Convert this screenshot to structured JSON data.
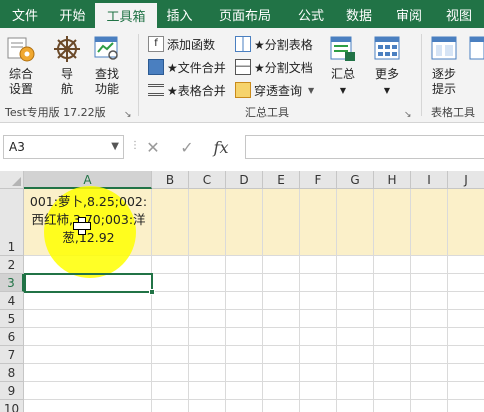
{
  "tabs": [
    "文件",
    "开始",
    "工具箱",
    "插入",
    "页面布局",
    "公式",
    "数据",
    "审阅",
    "视图"
  ],
  "active_tab_index": 2,
  "ribbon": {
    "group1": {
      "label": "Test专用版 17.22版",
      "buttons": [
        {
          "label": "综合\n设置",
          "icon": "gear-settings-icon"
        },
        {
          "label": "导\n航",
          "icon": "ship-wheel-icon"
        },
        {
          "label": "查找\n功能",
          "icon": "find-function-icon"
        }
      ]
    },
    "group2": {
      "label": "汇总工具",
      "small_buttons": [
        {
          "label": "添加函数",
          "icon": "add-function-icon"
        },
        {
          "label": "★文件合并",
          "icon": "file-merge-icon"
        },
        {
          "label": "★表格合并",
          "icon": "table-merge-icon"
        },
        {
          "label": "★分割表格",
          "icon": "split-table-icon"
        },
        {
          "label": "★分割文档",
          "icon": "split-doc-icon"
        },
        {
          "label": "穿透查询",
          "icon": "drill-query-icon",
          "dropdown": true
        }
      ],
      "big_buttons": [
        {
          "label": "汇总",
          "icon": "summary-icon",
          "dropdown": true
        },
        {
          "label": "更多",
          "icon": "more-icon",
          "dropdown": true
        }
      ]
    },
    "group3": {
      "label": "表格工具",
      "buttons": [
        {
          "label": "逐步\n提示",
          "icon": "step-hint-icon"
        },
        {
          "label": "",
          "icon": "table-tool-icon"
        }
      ]
    }
  },
  "formula_bar": {
    "name_box": "A3",
    "cancel_glyph": "✕",
    "enter_glyph": "✓",
    "fx_label": "fx",
    "formula": ""
  },
  "sheet": {
    "columns": [
      "A",
      "B",
      "C",
      "D",
      "E",
      "F",
      "G",
      "H",
      "I",
      "J"
    ],
    "rows": [
      "1",
      "2",
      "3",
      "4",
      "5",
      "6",
      "7",
      "8",
      "9",
      "10"
    ],
    "selected_cell": "A3",
    "cells": {
      "A1": "001:萝卜,8.25;002:西红柿,3.70;003:洋葱,12.92"
    }
  },
  "colors": {
    "accent": "#217346",
    "highlight_row": "#fbf0c9",
    "cursor_spot": "#ffff00"
  }
}
